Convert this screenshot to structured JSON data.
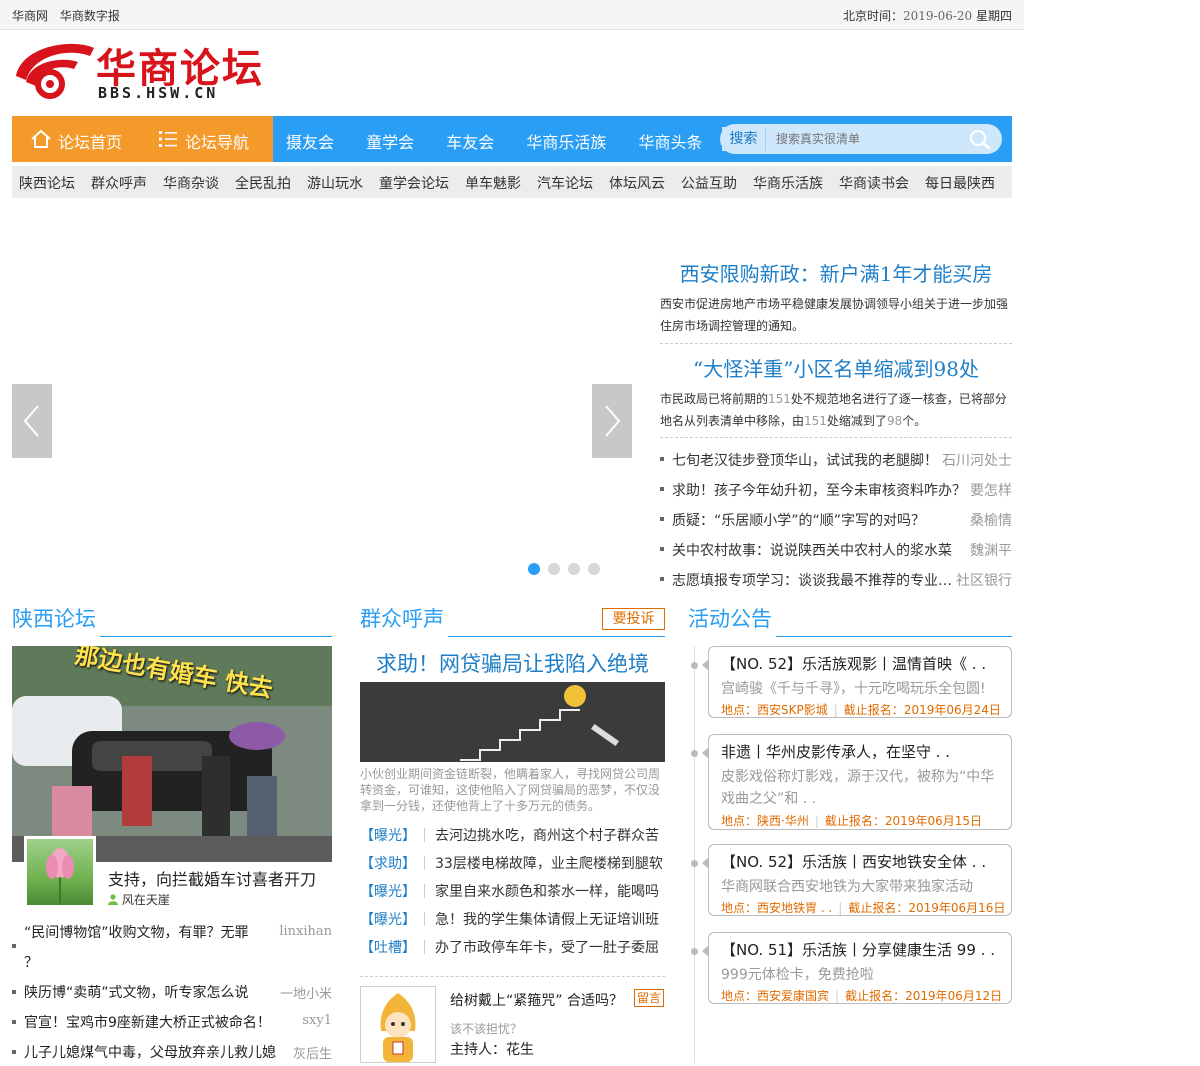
{
  "topbar": {
    "links": [
      "华商网",
      "华商数字报"
    ],
    "time_label": "北京时间：",
    "date": "2019-06-20",
    "weekday": "星期四"
  },
  "logo": {
    "name": "华商论坛",
    "domain": "BBS.HSW.CN"
  },
  "nav": {
    "home": "论坛首页",
    "guide": "论坛导航",
    "items": [
      "摄友会",
      "童学会",
      "车友会",
      "华商乐活族",
      "华商头条"
    ],
    "search_label": "搜索",
    "search_placeholder": "搜索真实很清单"
  },
  "subnav": [
    "陕西论坛",
    "群众呼声",
    "华商杂谈",
    "全民乱拍",
    "游山玩水",
    "童学会论坛",
    "单车魅影",
    "汽车论坛",
    "体坛风云",
    "公益互助",
    "华商乐活族",
    "华商读书会",
    "每日最陕西"
  ],
  "headlines": [
    {
      "title": "西安限购新政：新户满1年才能买房",
      "desc_parts": [
        "西安市促进房地产市场平稳健康发展协调领导小组关于进一步加强住房市场调控管理的通知。"
      ]
    },
    {
      "title": "“大怪洋重”小区名单缩减到98处",
      "desc_parts": [
        "市民政局已将前期的",
        "151",
        "处不规范地名进行了逐一核查，已将部分地名从列表清单中移除，由",
        "151",
        "处缩减到了",
        "98",
        "个。"
      ]
    }
  ],
  "headline_list": [
    {
      "title": "七旬老汉徒步登顶华山，试试我的老腿脚！",
      "user": "石川河处士"
    },
    {
      "title": "求助！孩子今年幼升初，至今未审核资料咋办？",
      "user": "要怎样"
    },
    {
      "title": "质疑：“乐居顺小学”的“顺”字写的对吗？",
      "user": "桑榆情"
    },
    {
      "title": "关中农村故事：说说陕西关中农村人的浆水菜",
      "user": "魏渊平"
    },
    {
      "title": "志愿填报专项学习：谈谈我最不推荐的专业…",
      "user": "社区银行"
    }
  ],
  "sections": {
    "shaanxi": "陕西论坛",
    "voice": "群众呼声",
    "activity": "活动公告"
  },
  "shaanxi": {
    "photo_text": "那边也有婚车 快去",
    "caption": "支持，向拦截婚车讨喜者开刀",
    "caption_user": "风在天崖",
    "list": [
      {
        "title": "“民间博物馆”收购文物，有罪？无罪",
        "title2": "？",
        "user": "linxihan"
      },
      {
        "title": "陕历博“卖萌”式文物，听专家怎么说",
        "user": "一地小米"
      },
      {
        "title": "官宣！宝鸡市9座新建大桥正式被命名！",
        "user": "sxy1"
      },
      {
        "title": "儿子儿媳煤气中毒，父母放弃亲儿救儿媳",
        "user": "灰后生"
      }
    ]
  },
  "voice": {
    "complain_btn": "要投诉",
    "title": "求助！网贷骗局让我陷入绝境",
    "desc": "小伙创业期间资金链断裂，他瞒着家人，寻找网贷公司周转资金，可谁知，这使他陷入了网贷骗局的恶梦，不仅没拿到一分钱，还使他背上了十多万元的债务。",
    "list": [
      {
        "tag": "【曝光】",
        "title": "去河边挑水吃，商州这个村子群众苦"
      },
      {
        "tag": "【求助】",
        "title": "33层楼电梯故障，业主爬楼梯到腿软"
      },
      {
        "tag": "【曝光】",
        "title": "家里自来水颜色和茶水一样，能喝吗"
      },
      {
        "tag": "【曝光】",
        "title": "急！我的学生集体请假上无证培训班"
      },
      {
        "tag": "【吐槽】",
        "title": "办了市政停车年卡，受了一肚子委屈"
      }
    ],
    "host_question": "给树戴上“紧箍咒” 合适吗？",
    "host_sub": "该不该担忧？",
    "host_name": "主持人：花生",
    "msg_btn": "留言"
  },
  "activities": [
    {
      "title": "【NO. 52】乐活族观影丨温情首映《 . .",
      "desc": "宫崎骏《千与千寻》，十元吃喝玩乐全包圆!",
      "place_label": "地点：",
      "place": "西安SKP影城",
      "deadline_label": "截止报名：",
      "deadline": "2019年06月24日"
    },
    {
      "title": "非遗丨华州皮影传承人，在坚守 . .",
      "desc": "皮影戏俗称灯影戏，源于汉代，被称为“中华戏曲之父”和 . .",
      "place_label": "地点：",
      "place": "陕西·华州",
      "deadline_label": "截止报名：",
      "deadline": "2019年06月15日"
    },
    {
      "title": "【NO. 52】乐活族丨西安地铁安全体 . .",
      "desc": "华商网联合西安地铁为大家带来独家活动",
      "place_label": "地点：",
      "place": "西安地铁胃 . .",
      "deadline_label": "截止报名：",
      "deadline": "2019年06月16日"
    },
    {
      "title": "【NO. 51】乐活族丨分享健康生活  99 . .",
      "desc": "999元体检卡，免费抢啦",
      "place_label": "地点：",
      "place": "西安爱康国宾",
      "deadline_label": "截止报名：",
      "deadline": "2019年06月12日"
    }
  ],
  "colors": {
    "brand_red": "#d7141c",
    "nav_blue": "#2a9df4",
    "home_orange": "#f39a2b",
    "accent_orange": "#e06b00"
  }
}
